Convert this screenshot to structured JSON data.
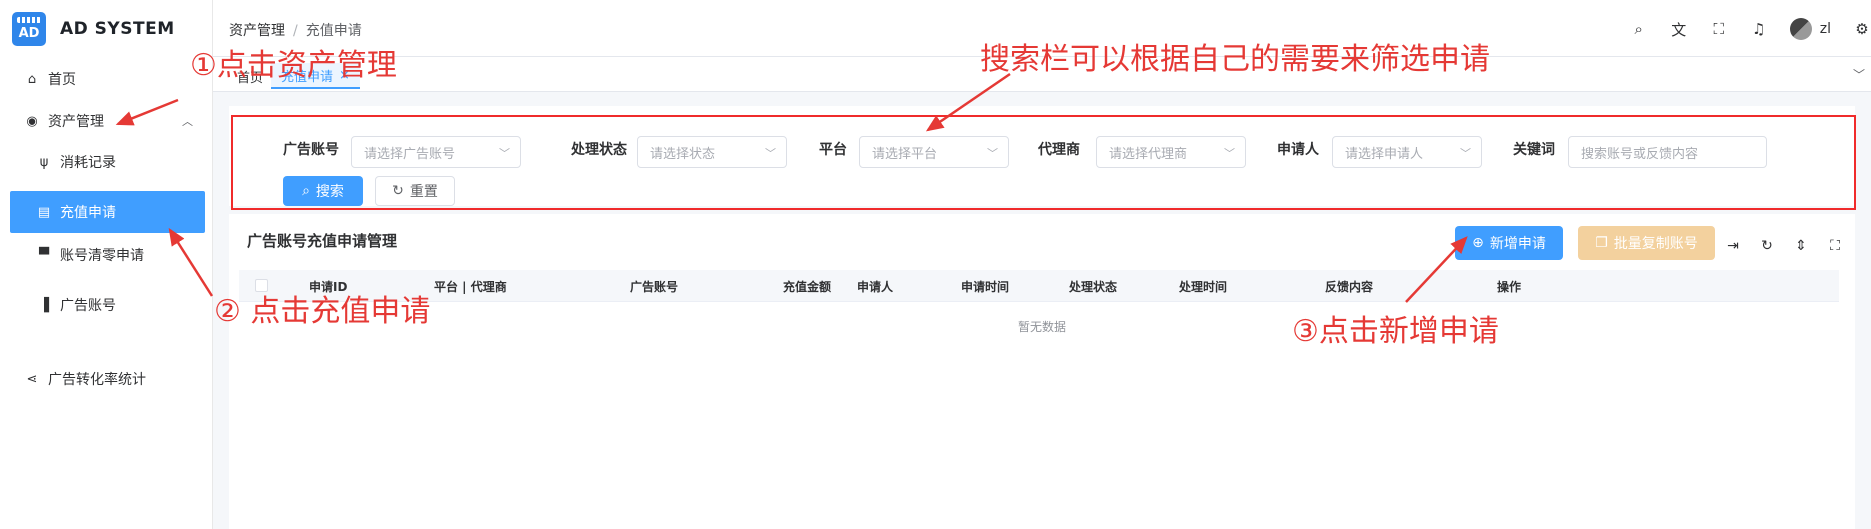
{
  "app": {
    "logo_badge": "AD",
    "title": "AD SYSTEM"
  },
  "sidebar": {
    "items": [
      {
        "label": "首页",
        "icon": "home-icon"
      },
      {
        "label": "资产管理",
        "icon": "asset-icon"
      },
      {
        "label": "消耗记录",
        "icon": "utensils-icon"
      },
      {
        "label": "充值申请",
        "icon": "document-icon"
      },
      {
        "label": "账号清零申请",
        "icon": "brush-icon"
      },
      {
        "label": "广告账号",
        "icon": "books-icon"
      },
      {
        "label": "广告转化率统计",
        "icon": "share-icon"
      }
    ]
  },
  "header": {
    "breadcrumb": [
      "资产管理",
      "充值申请"
    ],
    "user": "zl",
    "icons": [
      "search-icon",
      "translate-icon",
      "fullscreen-icon",
      "bell-icon",
      "avatar",
      "gear-icon"
    ]
  },
  "tabs": {
    "home": "首页",
    "active": "充值申请",
    "close": "×"
  },
  "filters": {
    "account": {
      "label": "广告账号",
      "placeholder": "请选择广告账号"
    },
    "status": {
      "label": "处理状态",
      "placeholder": "请选择状态"
    },
    "platform": {
      "label": "平台",
      "placeholder": "请选择平台"
    },
    "agent": {
      "label": "代理商",
      "placeholder": "请选择代理商"
    },
    "applicant": {
      "label": "申请人",
      "placeholder": "请选择申请人"
    },
    "keyword": {
      "label": "关键词",
      "placeholder": "搜索账号或反馈内容"
    },
    "search_button": "搜索",
    "reset_button": "重置"
  },
  "table": {
    "title": "广告账号充值申请管理",
    "new_button": "新增申请",
    "batch_button": "批量复制账号",
    "columns": [
      "申请ID",
      "平台 | 代理商",
      "广告账号",
      "充值金额",
      "申请人",
      "申请时间",
      "处理状态",
      "处理时间",
      "反馈内容",
      "操作"
    ],
    "empty_text": "暂无数据"
  },
  "annotations": {
    "step1": "①点击资产管理",
    "step2": "② 点击充值申请",
    "step3": "③点击新增申请",
    "search_note": "搜索栏可以根据自己的需要来筛选申请"
  },
  "colors": {
    "primary": "#409eff",
    "annotation": "#e53935",
    "warning_disabled": "#f3d19e"
  }
}
